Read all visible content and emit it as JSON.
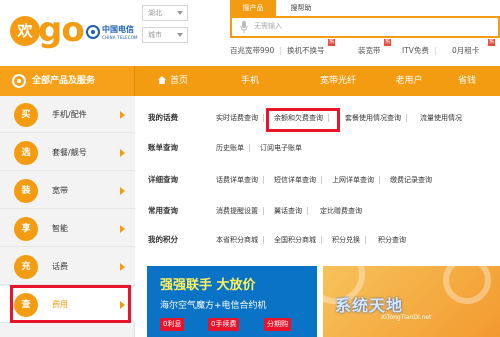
{
  "brand": {
    "logo_huan": "欢",
    "logo_go": "go",
    "telecom_name": "中国电信",
    "telecom_sub": "CHINA TELECOM"
  },
  "header": {
    "province_select": "湖北",
    "city_select": "城市",
    "search_tabs": [
      "搜产品",
      "搜帮助"
    ],
    "search_placeholder": "无需输入",
    "hot_links": [
      {
        "label": "百兆宽带990",
        "badge": ""
      },
      {
        "label": "换机不换号",
        "badge": "热"
      },
      {
        "label": "装宽带",
        "badge": "热"
      },
      {
        "label": "ITV免费",
        "badge": ""
      },
      {
        "label": "0月租卡",
        "badge": "热"
      }
    ]
  },
  "nav": {
    "all_products": "全部产品及服务",
    "items": [
      "首页",
      "手机",
      "宽带光纤",
      "老用户",
      "省钱"
    ]
  },
  "sidebar": {
    "items": [
      {
        "icon_char": "买",
        "label": "手机/配件"
      },
      {
        "icon_char": "选",
        "label": "套餐/靓号"
      },
      {
        "icon_char": "装",
        "label": "宽带"
      },
      {
        "icon_char": "享",
        "label": "智能"
      },
      {
        "icon_char": "充",
        "label": "话费"
      },
      {
        "icon_char": "查",
        "label": "费用"
      }
    ]
  },
  "fee_menu": {
    "rows": [
      {
        "label": "我的话费",
        "links": [
          "实时话费查询",
          "余额和欠费查询",
          "套餐使用情况查询",
          "流量使用情况"
        ]
      },
      {
        "label": "账单查询",
        "links": [
          "历史账单",
          "订阅电子账单"
        ]
      },
      {
        "label": "详细查询",
        "links": [
          "话费详单查询",
          "短信详单查询",
          "上网详单查询",
          "缴费记录查询"
        ]
      },
      {
        "label": "常用查询",
        "links": [
          "消费提醒设置",
          "翼话查询",
          "定比赠费查询"
        ]
      },
      {
        "label": "我的积分",
        "links": [
          "本省积分商城",
          "全国积分商城",
          "积分兑换",
          "积分查询"
        ]
      }
    ]
  },
  "banners": {
    "left": {
      "headline": "强强联手 大放价",
      "subline": "海尔空气魔方+电信合约机",
      "chips": [
        "0利息",
        "0手续费",
        "分期购"
      ]
    },
    "right": {
      "watermark": "系统天地",
      "watermark_sub": "XiTongTianDi.net"
    }
  },
  "colors": {
    "accent": "#f39c12",
    "highlight_red": "#e8142b",
    "banner_blue": "#0a73c5"
  }
}
